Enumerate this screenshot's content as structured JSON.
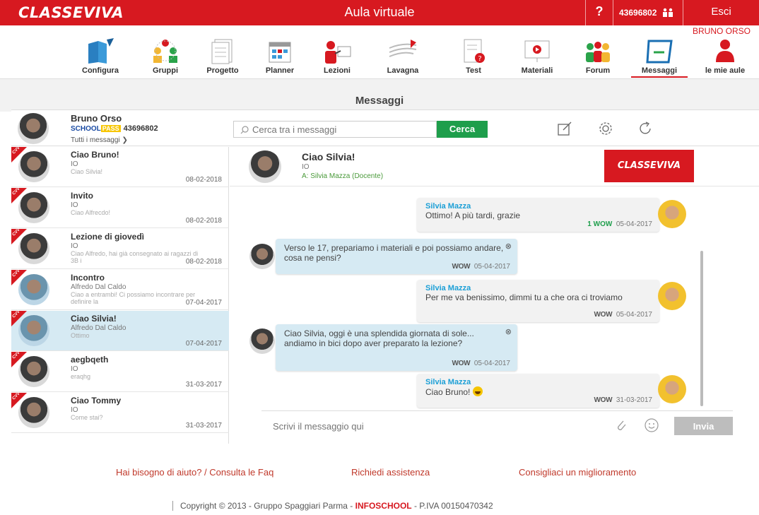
{
  "topbar": {
    "logo": "CLASSEVIVA",
    "title": "Aula virtuale",
    "help": "?",
    "user_code": "43696802",
    "exit": "Esci",
    "user_name": "BRUNO ORSO"
  },
  "nav": [
    {
      "label": "Configura"
    },
    {
      "label": "Gruppi"
    },
    {
      "label": "Progetto"
    },
    {
      "label": "Planner"
    },
    {
      "label": "Lezioni"
    },
    {
      "label": "Lavagna"
    },
    {
      "label": "Test"
    },
    {
      "label": "Materiali"
    },
    {
      "label": "Forum"
    },
    {
      "label": "Messaggi",
      "active": true
    },
    {
      "label": "le mie aule"
    }
  ],
  "page_title": "Messaggi",
  "profile": {
    "name": "Bruno Orso",
    "school": "SCHOOL",
    "pass": "PASS",
    "code": "43696802",
    "filter": "Tutti i messaggi"
  },
  "search": {
    "placeholder": "Cerca tra i messaggi",
    "button": "Cerca"
  },
  "colors": {
    "brand_red": "#d71920",
    "search_green": "#1e9e4b",
    "selected_bg": "#d6eaf3",
    "sender_blue": "#1b9fd6"
  },
  "conversations": [
    {
      "title": "Ciao Bruno!",
      "from": "IO",
      "preview": "Ciao Silvia!",
      "date": "08-02-2018",
      "badge": "CVV"
    },
    {
      "title": "Invito",
      "from": "IO",
      "preview": "Ciao Alfrecdo!",
      "date": "08-02-2018",
      "badge": "CVV"
    },
    {
      "title": "Lezione di giovedì",
      "from": "IO",
      "preview": "Ciao Alfredo, hai già consegnato ai ragazzi di 3B i",
      "date": "08-02-2018",
      "badge": "CVV"
    },
    {
      "title": "Incontro",
      "from": "Alfredo Dal Caldo",
      "preview": "Ciao a entrambi! Ci possiamo incontrare per definire la",
      "date": "07-04-2017",
      "badge": "CVV"
    },
    {
      "title": "Ciao Silvia!",
      "from": "Alfredo Dal Caldo",
      "preview": "Ottimo",
      "date": "07-04-2017",
      "badge": "CVV"
    },
    {
      "title": "aegbqeth",
      "from": "IO",
      "preview": "eraqhg",
      "date": "31-03-2017",
      "badge": "CVV"
    },
    {
      "title": "Ciao Tommy",
      "from": "IO",
      "preview": "Come stai?",
      "date": "31-03-2017",
      "badge": "CVV"
    }
  ],
  "chat": {
    "title": "Ciao Silvia!",
    "from": "IO",
    "to": "A: Silvia Mazza (Docente)",
    "brand": "CLASSEVIVA",
    "messages": [
      {
        "sender": "Silvia Mazza",
        "text": "Ottimo! A più tardi, grazie",
        "count": "1",
        "wow": "WOW",
        "date": "05-04-2017"
      },
      {
        "sender": "",
        "text": "Verso le 17, prepariamo i materiali e poi possiamo andare, cosa ne pensi?",
        "wow": "WOW",
        "date": "05-04-2017",
        "close": "⊗"
      },
      {
        "sender": "Silvia Mazza",
        "text": "Per me va benissimo, dimmi tu a che ora ci troviamo",
        "wow": "WOW",
        "date": "05-04-2017"
      },
      {
        "sender": "",
        "text": "Ciao Silvia, oggi è una splendida giornata di sole... andiamo in bici dopo aver preparato la lezione?",
        "wow": "WOW",
        "date": "05-04-2017",
        "close": "⊗"
      },
      {
        "sender": "Silvia Mazza",
        "text": "Ciao Bruno!",
        "wow": "WOW",
        "date": "31-03-2017"
      }
    ],
    "compose_placeholder": "Scrivi il messaggio qui",
    "send": "Invia"
  },
  "footer": {
    "help": "Hai bisogno di aiuto? / Consulta le Faq",
    "support": "Richiedi assistenza",
    "improve": "Consigliaci un miglioramento",
    "copyright_pre": "Copyright © 2013 - Gruppo Spaggiari Parma - ",
    "infoschool": "INFOSCHOOL",
    "copyright_post": " - P.IVA 00150470342"
  }
}
